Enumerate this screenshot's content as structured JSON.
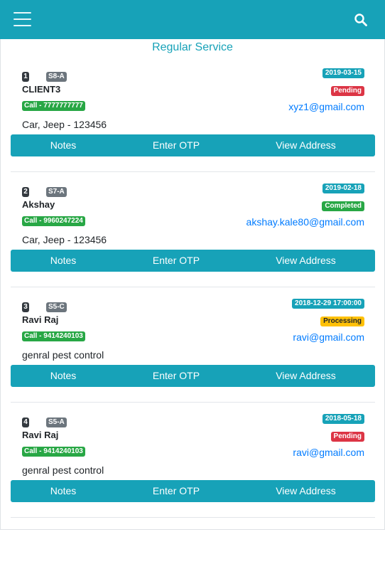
{
  "header": {
    "menu_icon": "hamburger-menu-icon",
    "search_icon": "search-icon",
    "background_color": "#17a2b8"
  },
  "page": {
    "title": "Regular Service"
  },
  "actions": {
    "notes": "Notes",
    "otp": "Enter OTP",
    "address": "View Address"
  },
  "colors": {
    "accent": "#17a2b8",
    "pending": "#dc3545",
    "completed": "#28a745",
    "processing": "#ffc107",
    "link": "#007bff"
  },
  "bookings": [
    {
      "number": "1",
      "code": "S8-A",
      "name": "CLIENT3",
      "call": "Call - 7777777777",
      "details": "Car, Jeep - 123456",
      "date": "2019-03-15",
      "status": "Pending",
      "email": "xyz1@gmail.com"
    },
    {
      "number": "2",
      "code": "S7-A",
      "name": "Akshay",
      "call": "Call - 9960247224",
      "details": "Car, Jeep - 123456",
      "date": "2019-02-18",
      "status": "Completed",
      "email": "akshay.kale80@gmail.com"
    },
    {
      "number": "3",
      "code": "S5-C",
      "name": "Ravi Raj",
      "call": "Call - 9414240103",
      "details": "genral pest control",
      "date": "2018-12-29 17:00:00",
      "status": "Processing",
      "email": "ravi@gmail.com"
    },
    {
      "number": "4",
      "code": "S5-A",
      "name": "Ravi Raj",
      "call": "Call - 9414240103",
      "details": "genral pest control",
      "date": "2018-05-18",
      "status": "Pending",
      "email": "ravi@gmail.com"
    }
  ]
}
